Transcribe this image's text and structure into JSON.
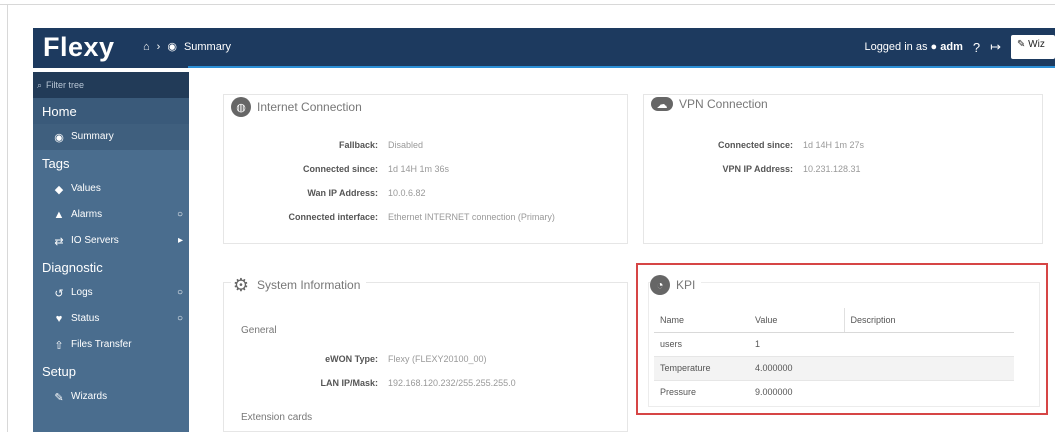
{
  "topbar": {
    "logo": "Flexy",
    "breadcrumb_sep": "›",
    "breadcrumb_current": "Summary",
    "logged_in_prefix": "Logged in as",
    "user": "adm",
    "wizard_label": "Wiz"
  },
  "sidebar": {
    "filter_placeholder": "Filter tree",
    "home": "Home",
    "summary": "Summary",
    "tags": "Tags",
    "values": "Values",
    "alarms": "Alarms",
    "io_servers": "IO Servers",
    "diagnostic": "Diagnostic",
    "logs": "Logs",
    "status": "Status",
    "files_transfer": "Files Transfer",
    "setup": "Setup",
    "wizards": "Wizards"
  },
  "internet": {
    "title": "Internet Connection",
    "rows": [
      {
        "label": "Fallback:",
        "value": "Disabled"
      },
      {
        "label": "Connected since:",
        "value": "1d 14H 1m 36s"
      },
      {
        "label": "Wan IP Address:",
        "value": "10.0.6.82"
      },
      {
        "label": "Connected interface:",
        "value": "Ethernet INTERNET connection (Primary)"
      }
    ]
  },
  "vpn": {
    "title": "VPN Connection",
    "rows": [
      {
        "label": "Connected since:",
        "value": "1d 14H 1m 27s"
      },
      {
        "label": "VPN IP Address:",
        "value": "10.231.128.31"
      }
    ]
  },
  "sysinfo": {
    "title": "System Information",
    "general": "General",
    "rows": [
      {
        "label": "eWON Type:",
        "value": "Flexy (FLEXY20100_00)"
      },
      {
        "label": "LAN IP/Mask:",
        "value": "192.168.120.232/255.255.255.0"
      }
    ],
    "extension": "Extension cards"
  },
  "kpi": {
    "title": "KPI",
    "headers": [
      "Name",
      "Value",
      "Description"
    ],
    "rows": [
      {
        "name": "users",
        "value": "1",
        "description": ""
      },
      {
        "name": "Temperature",
        "value": "4.000000",
        "description": ""
      },
      {
        "name": "Pressure",
        "value": "9.000000",
        "description": ""
      }
    ]
  },
  "colors": {
    "topbar": "#1d3a5f",
    "sidebar": "#4a6d8e",
    "accent": "#2c8fd6",
    "highlight_box": "#d64545"
  }
}
